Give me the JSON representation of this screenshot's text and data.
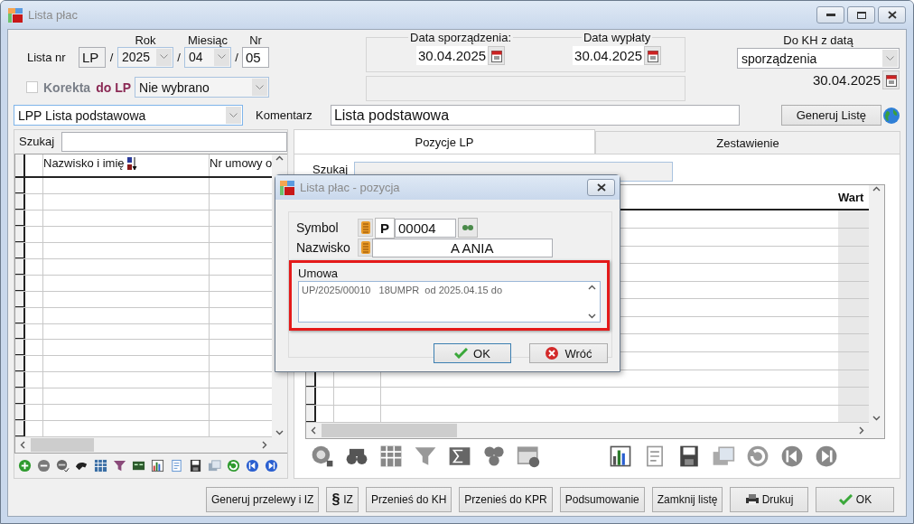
{
  "window": {
    "title": "Lista płac"
  },
  "header": {
    "label": "Lista nr",
    "prefix": "LP",
    "separators": [
      "/",
      "/",
      "/"
    ],
    "rok": {
      "label": "Rok",
      "value": "2025"
    },
    "miesiac": {
      "label": "Miesiąc",
      "value": "04"
    },
    "nr": {
      "label": "Nr",
      "value": "05"
    }
  },
  "korekta": {
    "checked": false,
    "label": "Korekta",
    "label_suffix": "do LP",
    "value": "Nie wybrano"
  },
  "dates": [
    {
      "label": "Data sporządzenia:",
      "value": "30.04.2025"
    },
    {
      "label": "Data wypłaty",
      "value": "30.04.2025"
    }
  ],
  "do_kh": {
    "label": "Do KH z datą",
    "value": "sporządzenia",
    "date": "30.04.2025"
  },
  "list_type": "LPP Lista podstawowa",
  "comment": {
    "label": "Komentarz",
    "value": "Lista podstawowa"
  },
  "generate_button": "Generuj Listę",
  "left_panel": {
    "search_label": "Szukaj",
    "columns": [
      "Nazwisko i imię",
      "Nr umowy o"
    ]
  },
  "tabs": [
    {
      "label": "Pozycje LP",
      "selected": true
    },
    {
      "label": "Zestawienie",
      "selected": false
    }
  ],
  "right_panel": {
    "search_label": "Szukaj",
    "column": "Wart"
  },
  "buttons": [
    {
      "label": "Generuj przelewy i IZ"
    },
    {
      "label": "IZ",
      "icon": "§"
    },
    {
      "label": "Przenieś do KH"
    },
    {
      "label": "Przenieś do KPR"
    },
    {
      "label": "Podsumowanie"
    },
    {
      "label": "Zamknij listę"
    },
    {
      "label": "Drukuj",
      "kind": "print"
    },
    {
      "label": "OK",
      "kind": "ok"
    }
  ],
  "dialog": {
    "title": "Lista płac - pozycja",
    "symbol": {
      "label": "Symbol",
      "prefix": "P",
      "value": "00004"
    },
    "nazwisko": {
      "label": "Nazwisko",
      "value": "A ANIA"
    },
    "umowa": {
      "label": "Umowa",
      "value": "UP/2025/00010   18UMPR  od 2025.04.15 do",
      "highlighted": true
    },
    "ok": "OK",
    "cancel": "Wróć"
  }
}
